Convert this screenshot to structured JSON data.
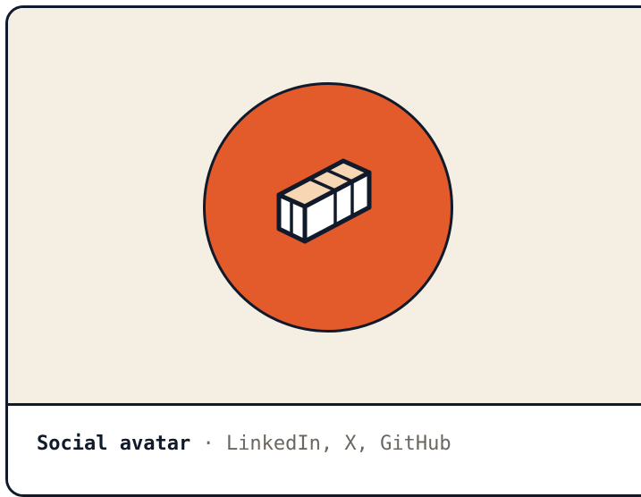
{
  "card": {
    "title": "Social avatar",
    "separator": "·",
    "subtitle": "LinkedIn, X, GitHub"
  },
  "icons": {
    "avatar_icon": "brick-icon"
  },
  "colors": {
    "background": "#f4efe2",
    "accent": "#e45b2b",
    "outline": "#111a2b",
    "brick_top": "#f6d6b3",
    "brick_side": "#ffffff",
    "muted_text": "#6b6660"
  }
}
